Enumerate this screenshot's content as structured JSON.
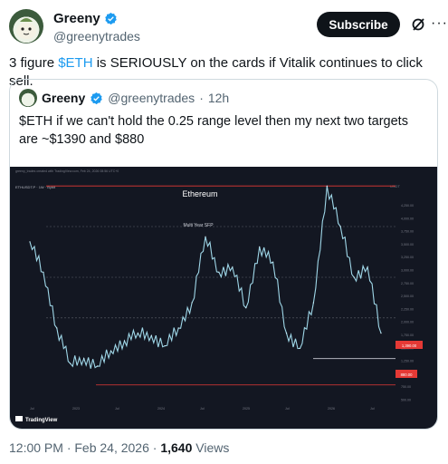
{
  "author": {
    "name": "Greeny",
    "handle": "@greenytrades"
  },
  "actions": {
    "subscribe_label": "Subscribe",
    "grok_icon": "grok-slash-icon",
    "more_icon": "more-dots-icon"
  },
  "tweet": {
    "text_before": "3 figure ",
    "cashtag": "$ETH",
    "text_after": " is SERIOUSLY on the cards if Vitalik continues to click sell."
  },
  "quote": {
    "name": "Greeny",
    "handle": "@greenytrades",
    "dot": "·",
    "time": "12h",
    "text": "$ETH if we can't hold the 0.25 range level then my next two targets are ~$1390 and $880"
  },
  "chart": {
    "title": "Ethereum",
    "header_note": "greeny_trades created with TradingView.com, Feb 24, 2026 08:56 UTC+0",
    "symbol_line": "ETHUSDT.P · 1W · Bybit",
    "sfp_label": "Multi Year SFP",
    "target1_label": "1,390.00",
    "target2_label": "880.00",
    "watermark": "TradingView",
    "y_axis_ticks": [
      "4,250.00",
      "4,000.00",
      "3,750.00",
      "3,500.00",
      "3,250.00",
      "3,000.00",
      "2,750.00",
      "2,500.00",
      "2,250.00",
      "2,000.00",
      "1,750.00",
      "1,500.00",
      "1,250.00",
      "1,000.00",
      "750.00",
      "500.00"
    ],
    "x_axis_ticks": [
      "Jul",
      "2023",
      "Jul",
      "2024",
      "Jul",
      "2025",
      "Jul",
      "2026",
      "Jul"
    ],
    "currency": "USDT"
  },
  "chart_data": {
    "type": "line",
    "title": "Ethereum",
    "xlabel": "",
    "ylabel": "",
    "x": [
      "2022-01",
      "2022-03",
      "2022-05",
      "2022-07",
      "2022-09",
      "2022-11",
      "2023-01",
      "2023-03",
      "2023-05",
      "2023-07",
      "2023-09",
      "2023-11",
      "2024-01",
      "2024-03",
      "2024-05",
      "2024-07",
      "2024-09",
      "2024-11",
      "2025-01",
      "2025-03",
      "2025-05",
      "2025-07",
      "2025-08",
      "2025-10",
      "2025-12",
      "2026-01",
      "2026-02"
    ],
    "series": [
      {
        "values": [
          3700,
          3100,
          2000,
          1300,
          1400,
          1250,
          1550,
          1750,
          1900,
          1850,
          1650,
          2000,
          2500,
          3800,
          3100,
          3200,
          2400,
          3600,
          3300,
          1900,
          1600,
          2500,
          4800,
          4000,
          3000,
          3200,
          1900
        ]
      }
    ],
    "levels": [
      {
        "label": "Multi Year SFP",
        "value": 4800
      },
      {
        "label": "",
        "value": 1400
      },
      {
        "label": "",
        "value": 880
      }
    ],
    "ylim": [
      500,
      4500
    ],
    "grid": false
  }
}
